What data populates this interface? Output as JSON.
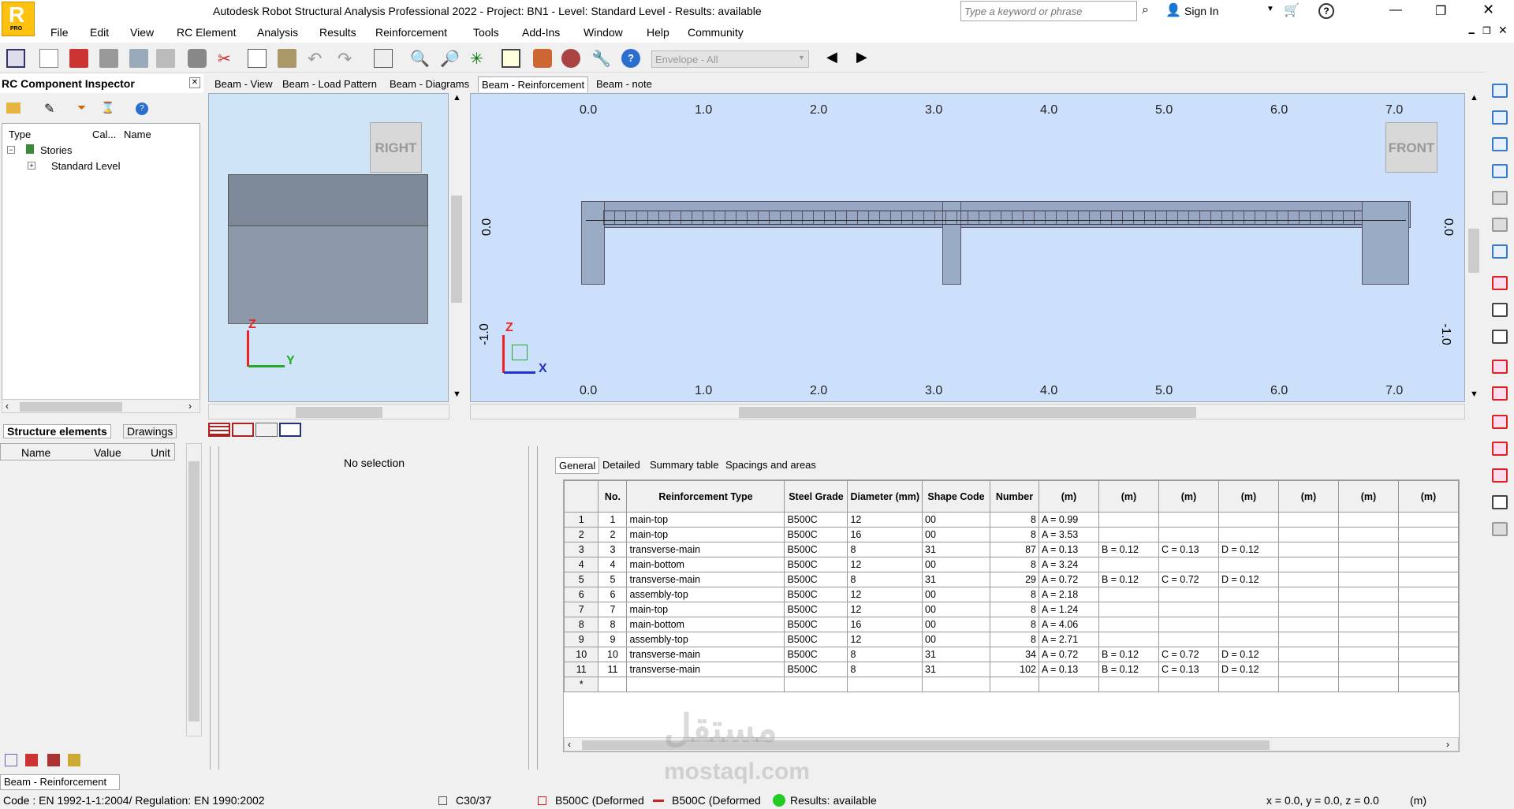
{
  "app": {
    "title": "Autodesk Robot Structural Analysis Professional 2022 - Project: BN1 - Level: Standard Level - Results: available",
    "logo_letter": "R",
    "logo_sub": "PRO",
    "search_placeholder": "Type a keyword or phrase",
    "signin": "Sign In"
  },
  "menu": [
    "File",
    "Edit",
    "View",
    "RC Element",
    "Analysis",
    "Results",
    "Reinforcement",
    "Tools",
    "Add-Ins",
    "Window",
    "Help",
    "Community"
  ],
  "toolbar": {
    "envelope": "Envelope - All"
  },
  "inspector": {
    "title": "RC Component Inspector",
    "col_type": "Type",
    "col_cal": "Cal...",
    "col_name": "Name",
    "stories": "Stories",
    "level": "Standard Level",
    "tab1": "Structure elements",
    "tab2": "Drawings"
  },
  "props": {
    "name": "Name",
    "value": "Value",
    "unit": "Unit"
  },
  "viewtabs": [
    "Beam - View",
    "Beam - Load Pattern",
    "Beam - Diagrams",
    "Beam - Reinforcement",
    "Beam - note"
  ],
  "left_view": {
    "cube": "RIGHT",
    "z": "Z",
    "y": "Y"
  },
  "main_view": {
    "cube": "FRONT",
    "ticks": [
      "0.0",
      "1.0",
      "2.0",
      "3.0",
      "4.0",
      "5.0",
      "6.0",
      "7.0"
    ],
    "vzero": "0.0",
    "vminus": "-1.0",
    "z": "Z",
    "x": "X"
  },
  "selection": "No selection",
  "grid_tabs": [
    "General",
    "Detailed",
    "Summary table",
    "Spacings and areas"
  ],
  "grid": {
    "headers": [
      "No.",
      "Reinforcement Type",
      "Steel Grade",
      "Diameter (mm)",
      "Shape Code",
      "Number",
      "(m)",
      "(m)",
      "(m)",
      "(m)",
      "(m)",
      "(m)",
      "(m)"
    ],
    "rows": [
      [
        "1",
        "1",
        "main-top",
        "B500C",
        "12",
        "00",
        "8",
        "A = 0.99",
        "",
        "",
        "",
        "",
        "",
        ""
      ],
      [
        "2",
        "2",
        "main-top",
        "B500C",
        "16",
        "00",
        "8",
        "A = 3.53",
        "",
        "",
        "",
        "",
        "",
        ""
      ],
      [
        "3",
        "3",
        "transverse-main",
        "B500C",
        "8",
        "31",
        "87",
        "A = 0.13",
        "B = 0.12",
        "C = 0.13",
        "D = 0.12",
        "",
        "",
        ""
      ],
      [
        "4",
        "4",
        "main-bottom",
        "B500C",
        "12",
        "00",
        "8",
        "A = 3.24",
        "",
        "",
        "",
        "",
        "",
        ""
      ],
      [
        "5",
        "5",
        "transverse-main",
        "B500C",
        "8",
        "31",
        "29",
        "A = 0.72",
        "B = 0.12",
        "C = 0.72",
        "D = 0.12",
        "",
        "",
        ""
      ],
      [
        "6",
        "6",
        "assembly-top",
        "B500C",
        "12",
        "00",
        "8",
        "A = 2.18",
        "",
        "",
        "",
        "",
        "",
        ""
      ],
      [
        "7",
        "7",
        "main-top",
        "B500C",
        "12",
        "00",
        "8",
        "A = 1.24",
        "",
        "",
        "",
        "",
        "",
        ""
      ],
      [
        "8",
        "8",
        "main-bottom",
        "B500C",
        "16",
        "00",
        "8",
        "A = 4.06",
        "",
        "",
        "",
        "",
        "",
        ""
      ],
      [
        "9",
        "9",
        "assembly-top",
        "B500C",
        "12",
        "00",
        "8",
        "A = 2.71",
        "",
        "",
        "",
        "",
        "",
        ""
      ],
      [
        "10",
        "10",
        "transverse-main",
        "B500C",
        "8",
        "31",
        "34",
        "A = 0.72",
        "B = 0.12",
        "C = 0.72",
        "D = 0.12",
        "",
        "",
        ""
      ],
      [
        "11",
        "11",
        "transverse-main",
        "B500C",
        "8",
        "31",
        "102",
        "A = 0.13",
        "B = 0.12",
        "C = 0.13",
        "D = 0.12",
        "",
        "",
        ""
      ],
      [
        "*",
        "",
        "",
        "",
        "",
        "",
        "",
        "",
        "",
        "",
        "",
        "",
        "",
        ""
      ]
    ]
  },
  "bottom_tab": "Beam - Reinforcement",
  "status": {
    "code": "Code : EN 1992-1-1:2004/  Regulation: EN 1990:2002",
    "concrete": "C30/37",
    "steel1": "B500C (Deformed",
    "steel2": "B500C (Deformed",
    "results": "Results: available",
    "coords": "x = 0.0, y = 0.0, z = 0.0",
    "unit": "(m)"
  },
  "watermark": {
    "arabic": "مستقل",
    "latin": "mostaql.com"
  }
}
